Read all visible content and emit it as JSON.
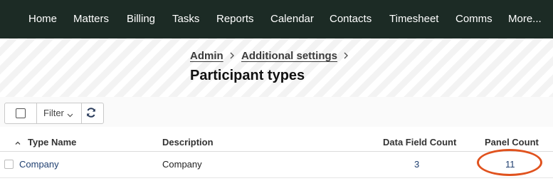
{
  "nav": {
    "items": [
      "Home",
      "Matters",
      "Billing",
      "Tasks",
      "Reports",
      "Calendar",
      "Contacts",
      "Timesheet",
      "Comms",
      "More..."
    ]
  },
  "breadcrumb": {
    "items": [
      "Admin",
      "Additional settings"
    ]
  },
  "page": {
    "title": "Participant types"
  },
  "toolbar": {
    "filter_label": "Filter"
  },
  "table": {
    "columns": [
      "Type Name",
      "Description",
      "Data Field Count",
      "Panel Count"
    ],
    "rows": [
      {
        "type_name": "Company",
        "description": "Company",
        "data_field_count": "3",
        "panel_count": "11"
      }
    ]
  },
  "colors": {
    "nav_bg": "#1c2b25",
    "link": "#1f3f70",
    "highlight": "#e0521e"
  },
  "icons": [
    "checkbox-icon",
    "chevron-down-icon",
    "refresh-icon",
    "sort-up-icon",
    "chevron-right-icon"
  ]
}
